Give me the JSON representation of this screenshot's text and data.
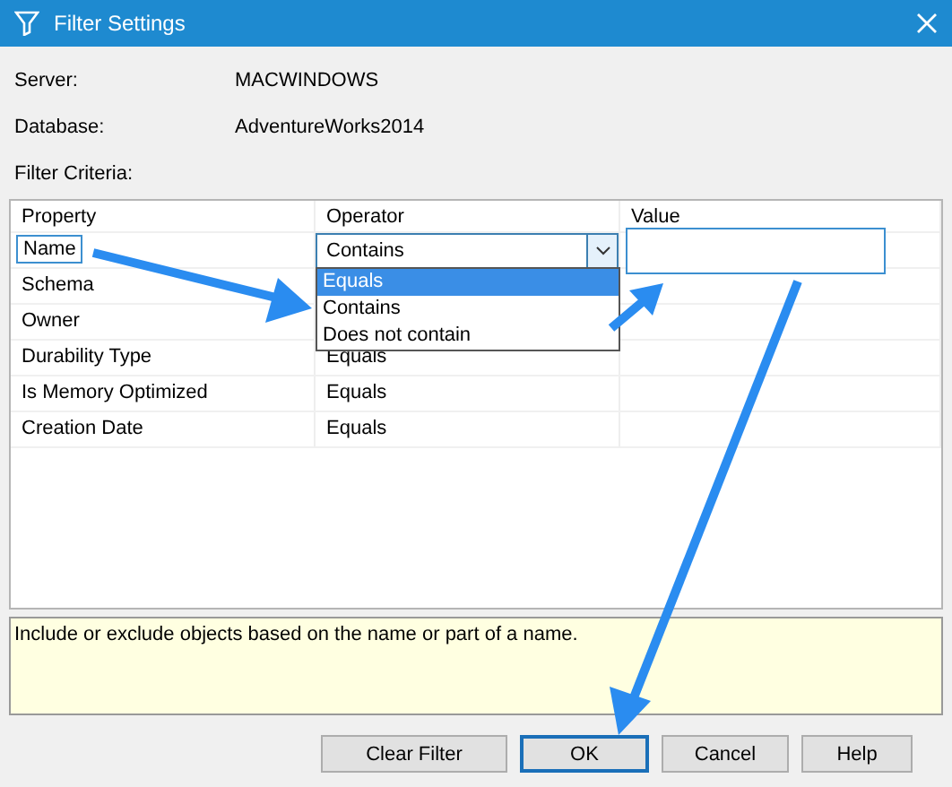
{
  "window": {
    "title": "Filter Settings"
  },
  "info": [
    {
      "label": "Server:",
      "value": "MACWINDOWS"
    },
    {
      "label": "Database:",
      "value": "AdventureWorks2014"
    }
  ],
  "criteria_label": "Filter Criteria:",
  "grid": {
    "columns": [
      "Property",
      "Operator",
      "Value"
    ],
    "rows": [
      {
        "kind": "editing",
        "property": "Name",
        "operator": "Contains"
      },
      {
        "kind": "plain",
        "property": "Schema"
      },
      {
        "kind": "plain",
        "property": "Owner"
      },
      {
        "kind": "plain",
        "property": "Durability Type",
        "operator": "Equals"
      },
      {
        "kind": "plain",
        "property": "Is Memory Optimized",
        "operator": "Equals"
      },
      {
        "kind": "plain",
        "property": "Creation Date",
        "operator": "Equals"
      }
    ],
    "dropdown": [
      {
        "label": "Equals",
        "selected": true
      },
      {
        "label": "Contains",
        "selected": false
      },
      {
        "label": "Does not contain",
        "selected": false
      }
    ]
  },
  "description": "Include or exclude objects based on the name or part of a name.",
  "buttons": [
    {
      "label": "Clear Filter",
      "default": false
    },
    {
      "label": "OK",
      "default": true
    },
    {
      "label": "Cancel",
      "default": false
    },
    {
      "label": "Help",
      "default": false
    }
  ]
}
